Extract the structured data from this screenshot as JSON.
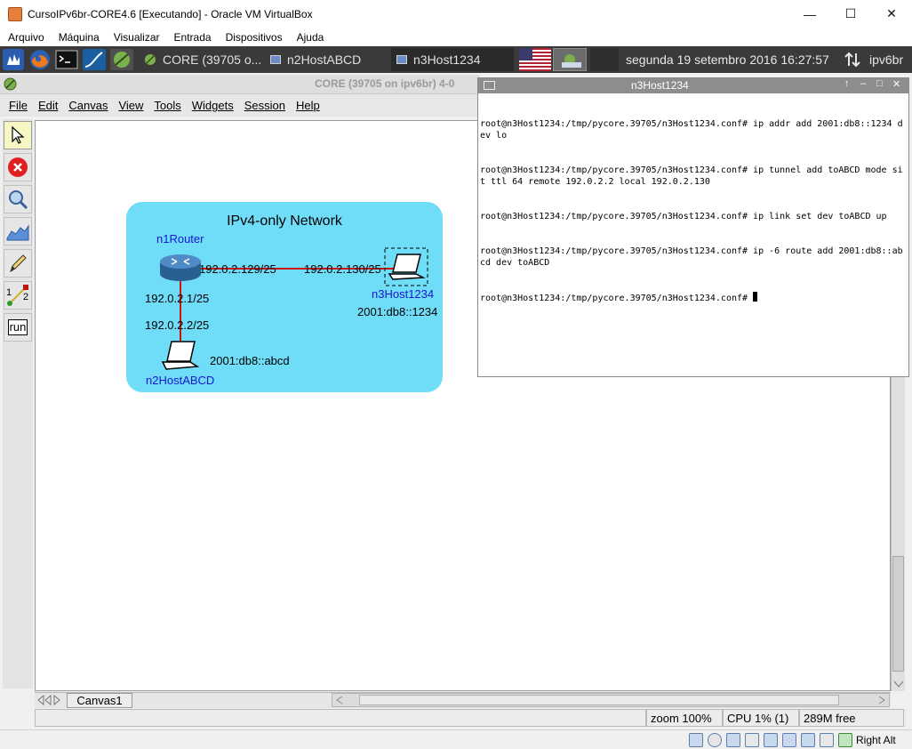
{
  "host_window": {
    "title": "CursoIPv6br-CORE4.6 [Executando] - Oracle VM VirtualBox",
    "controls": {
      "minimize": "—",
      "maximize": "☐",
      "close": "✕"
    },
    "menu": [
      "Arquivo",
      "Máquina",
      "Visualizar",
      "Entrada",
      "Dispositivos",
      "Ajuda"
    ],
    "status_right": "Right Alt"
  },
  "guest_panel": {
    "tasks": [
      {
        "label": "CORE (39705 o..."
      },
      {
        "label": "n2HostABCD"
      },
      {
        "label": "n3Host1234"
      }
    ],
    "clock": "segunda 19 setembro 2016 16:27:57",
    "hostname": "ipv6br",
    "colors": {
      "panel_bg": "#3a3a3a"
    }
  },
  "core_window": {
    "title": "CORE (39705 on ipv6br) 4-0",
    "menu": [
      "File",
      "Edit",
      "Canvas",
      "View",
      "Tools",
      "Widgets",
      "Session",
      "Help"
    ],
    "toolbar": [
      {
        "name": "select-tool",
        "icon": "arrow-pointer-icon"
      },
      {
        "name": "stop-session",
        "icon": "stop-icon"
      },
      {
        "name": "observer-widgets",
        "icon": "magnifier-icon"
      },
      {
        "name": "plot-tool",
        "icon": "chart-icon"
      },
      {
        "name": "marker-tool",
        "icon": "pencil-icon"
      },
      {
        "name": "two-node-tool",
        "icon": "link-icon",
        "labels": [
          "1",
          "2"
        ]
      },
      {
        "name": "run-tool",
        "icon": "run-icon",
        "label": "run"
      }
    ],
    "canvas": {
      "network_label": "IPv4-only Network",
      "region_color": "#6fdcf8",
      "link_color": "#d01010",
      "nodes": [
        {
          "name": "n1Router",
          "type": "router"
        },
        {
          "name": "n3Host1234",
          "type": "laptop",
          "ipv6": "2001:db8::1234"
        },
        {
          "name": "n2HostABCD",
          "type": "laptop",
          "ipv6": "2001:db8::abcd"
        }
      ],
      "links": [
        {
          "a_addr": "192.0.2.129/25",
          "b_addr": "192.0.2.130/25"
        },
        {
          "a_addr": "192.0.2.1/25",
          "b_addr": "192.0.2.2/25"
        }
      ]
    },
    "tab": "Canvas1",
    "status": {
      "zoom": "zoom 100%",
      "cpu": "CPU 1% (1)",
      "mem": "289M free"
    }
  },
  "terminal": {
    "title": "n3Host1234",
    "lines": [
      "root@n3Host1234:/tmp/pycore.39705/n3Host1234.conf# ip addr add 2001:db8::1234 dev lo",
      "root@n3Host1234:/tmp/pycore.39705/n3Host1234.conf# ip tunnel add toABCD mode sit ttl 64 remote 192.0.2.2 local 192.0.2.130",
      "root@n3Host1234:/tmp/pycore.39705/n3Host1234.conf# ip link set dev toABCD up",
      "root@n3Host1234:/tmp/pycore.39705/n3Host1234.conf# ip -6 route add 2001:db8::abcd dev toABCD",
      "root@n3Host1234:/tmp/pycore.39705/n3Host1234.conf# "
    ]
  }
}
